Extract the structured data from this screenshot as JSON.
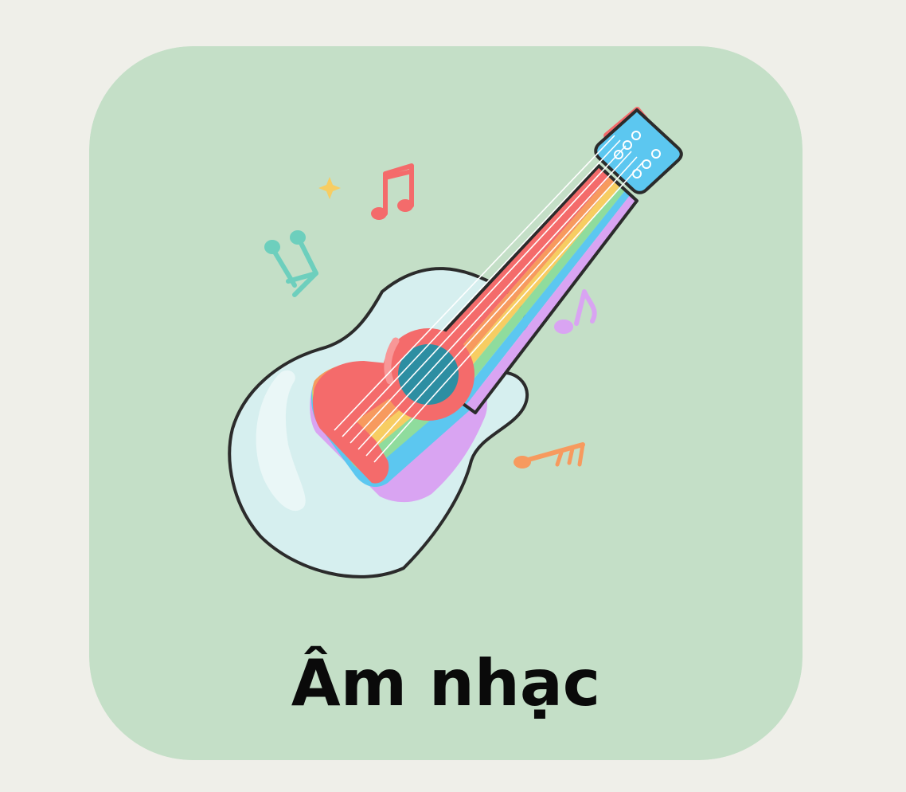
{
  "card": {
    "label": "Âm nhạc",
    "background_color": "#c4dfc7",
    "page_background_color": "#efefe9"
  },
  "illustration": {
    "subject": "guitar-icon",
    "decorations": [
      "music-note-icon",
      "sparkle-icon"
    ],
    "palette": {
      "outline": "#2b2b2b",
      "body": "#d6efef",
      "red": "#f46b6b",
      "orange": "#f79a5e",
      "yellow": "#f7cd62",
      "green": "#8fdc9d",
      "blue": "#5cc7f0",
      "purple": "#d9a4f2",
      "teal": "#6dcfbd",
      "soundhole": "#2d8ea2"
    }
  }
}
